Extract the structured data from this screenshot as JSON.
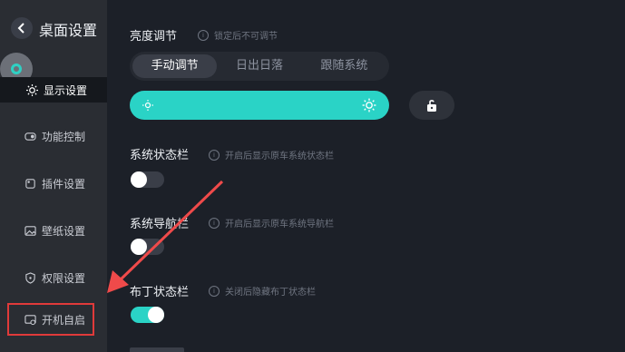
{
  "header": {
    "title": "桌面设置"
  },
  "sidebar": {
    "items": [
      {
        "label": "显示设置",
        "icon": "sun-icon",
        "active": true
      },
      {
        "label": "功能控制",
        "icon": "toggle-icon"
      },
      {
        "label": "插件设置",
        "icon": "plugin-icon"
      },
      {
        "label": "壁纸设置",
        "icon": "image-icon"
      },
      {
        "label": "权限设置",
        "icon": "shield-icon"
      },
      {
        "label": "开机自启",
        "icon": "boot-icon",
        "highlighted": true
      }
    ]
  },
  "brightness": {
    "title": "亮度调节",
    "hint": "锁定后不可调节",
    "modes": [
      "手动调节",
      "日出日落",
      "跟随系统"
    ],
    "selected_mode": "手动调节"
  },
  "settings": [
    {
      "title": "系统状态栏",
      "hint": "开启后显示原车系统状态栏",
      "enabled": false
    },
    {
      "title": "系统导航栏",
      "hint": "开启后显示原车系统导航栏",
      "enabled": false
    },
    {
      "title": "布丁状态栏",
      "hint": "关闭后隐藏布丁状态栏",
      "enabled": true
    }
  ],
  "colors": {
    "accent": "#2ad3c6",
    "sidebar_bg": "#2a2d33",
    "main_bg": "#1c2028",
    "highlight": "#e03a3a",
    "arrow": "#ef4a4a"
  }
}
